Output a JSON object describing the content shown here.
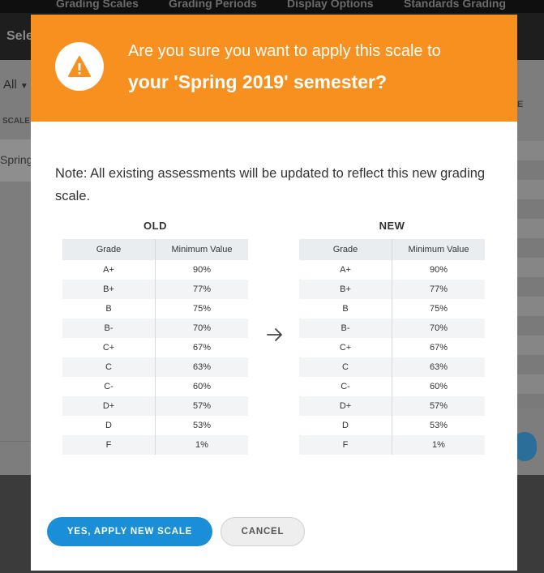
{
  "background": {
    "top_tabs": [
      "Grading Scales",
      "Grading Periods",
      "Display Options",
      "Standards Grading"
    ],
    "subbar_text": "Sele",
    "filter_label": "All",
    "column_label": "SCALE",
    "row_text": "Spring",
    "right_column_label": "E"
  },
  "modal": {
    "header_line1": "Are you sure you want to apply this scale to",
    "header_line2": "your 'Spring 2019' semester?",
    "note": "Note: All existing assessments will be updated to reflect this new grading scale.",
    "old_title": "OLD",
    "new_title": "NEW",
    "column_headers": [
      "Grade",
      "Minimum Value"
    ],
    "old_rows": [
      [
        "A+",
        "90%"
      ],
      [
        "B+",
        "77%"
      ],
      [
        "B",
        "75%"
      ],
      [
        "B-",
        "70%"
      ],
      [
        "C+",
        "67%"
      ],
      [
        "C",
        "63%"
      ],
      [
        "C-",
        "60%"
      ],
      [
        "D+",
        "57%"
      ],
      [
        "D",
        "53%"
      ],
      [
        "F",
        "1%"
      ]
    ],
    "new_rows": [
      [
        "A+",
        "90%"
      ],
      [
        "B+",
        "77%"
      ],
      [
        "B",
        "75%"
      ],
      [
        "B-",
        "70%"
      ],
      [
        "C+",
        "67%"
      ],
      [
        "C",
        "63%"
      ],
      [
        "C-",
        "60%"
      ],
      [
        "D+",
        "57%"
      ],
      [
        "D",
        "53%"
      ],
      [
        "F",
        "1%"
      ]
    ],
    "apply_button": "YES, APPLY NEW SCALE",
    "cancel_button": "CANCEL",
    "icons": {
      "warning": "warning-icon",
      "arrow": "arrow-right-icon"
    }
  },
  "colors": {
    "header": "#f7901e",
    "primary": "#1a8ed6"
  }
}
